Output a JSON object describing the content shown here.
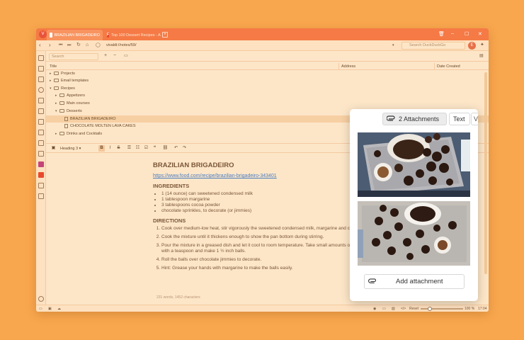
{
  "tabs": [
    {
      "label": "BRAZILIAN BRIGADEIRO"
    },
    {
      "label": "Top 100 Dessert Recipes - A"
    }
  ],
  "address": {
    "url": "vivaldi://notes/59/",
    "search_placeholder": "Search DuckDuckGo",
    "avatar_initial": "E"
  },
  "notes_toolbar": {
    "filter_placeholder": "Search"
  },
  "columns": {
    "title": "Title",
    "address": "Address",
    "date_created": "Date Created"
  },
  "tree": [
    {
      "label": "Projects"
    },
    {
      "label": "Email templates"
    },
    {
      "label": "Recipes"
    },
    {
      "label": "Appetizers"
    },
    {
      "label": "Main courses"
    },
    {
      "label": "Desserts"
    },
    {
      "label": "BRAZILIAN BRIGADEIRO"
    },
    {
      "label": "CHOCOLATE MOLTEN LAVA CAKES"
    },
    {
      "label": "Drinks and Cocktails"
    }
  ],
  "format_bar": {
    "heading_select": "Heading 3",
    "bold": "B",
    "italic": "I",
    "strike": "S"
  },
  "note": {
    "title": "BRAZILIAN BRIGADEIRO",
    "link": "https://www.food.com/recipe/brazilian-brigadeiro-343401",
    "ingredients_heading": "INGREDIENTS",
    "ingredients": [
      "1 (14 ounce) can sweetened condensed milk",
      "1 tablespoon margarine",
      "3 tablespoons cocoa powder",
      "chocolate sprinkles, to decorate (or jimmies)"
    ],
    "directions_heading": "DIRECTIONS",
    "directions": [
      "Cook over medium-low heat, stir vigorously the sweetened condensed milk, margarine and cocoa powder",
      "Cook the mixture until it thickens enough to show the pan bottom during stirring.",
      "Pour the mixture in a greased dish and let it cool to room temperature. Take small amounts of the mixture with a teaspoon and make 1 ½ inch balls.",
      "Roll the balls over chocolate jimmies to decorate.",
      "Hint: Grease your hands with margarine to make the balls easily."
    ],
    "word_count": "231 words, 1452 characters"
  },
  "statusbar": {
    "reset": "Reset",
    "zoom": "100 %",
    "time": "17:04"
  },
  "popup": {
    "attachments_label": "2 Attachments",
    "text_label": "Text",
    "more_label": "Vi",
    "add_attachment_label": "Add attachment"
  },
  "colors": {
    "accent": "#f57a45",
    "background": "#f9a74e",
    "link": "#4a7cc0"
  }
}
